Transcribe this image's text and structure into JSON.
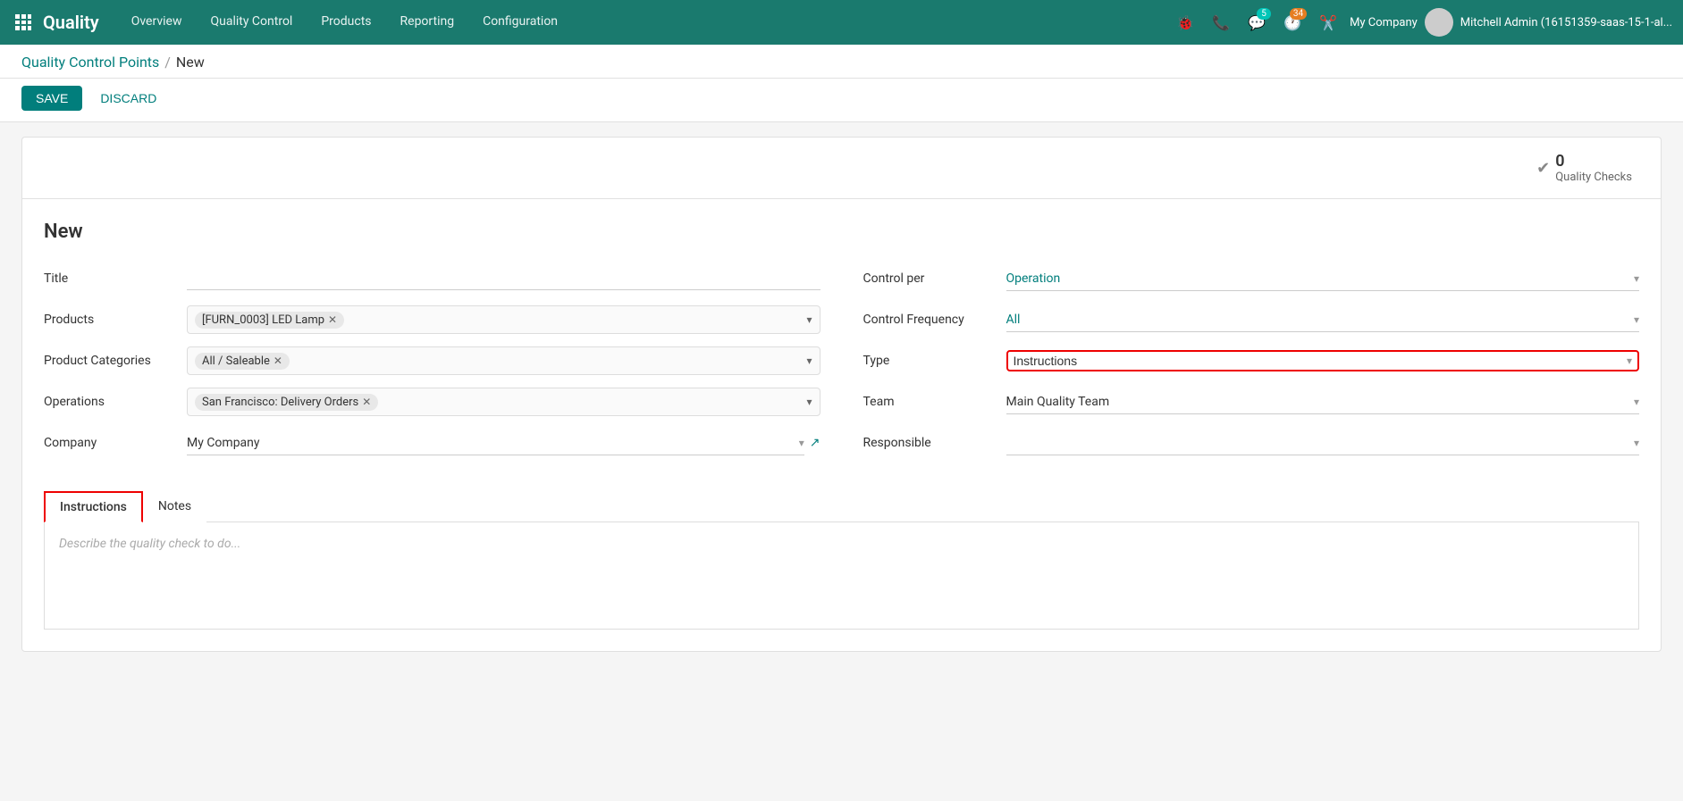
{
  "nav": {
    "app_name": "Quality",
    "menu_items": [
      "Overview",
      "Quality Control",
      "Products",
      "Reporting",
      "Configuration"
    ],
    "badge_chat": "5",
    "badge_clock": "34",
    "company": "My Company",
    "user": "Mitchell Admin (16151359-saas-15-1-al..."
  },
  "breadcrumb": {
    "parent": "Quality Control Points",
    "separator": "/",
    "current": "New"
  },
  "actions": {
    "save": "SAVE",
    "discard": "DISCARD"
  },
  "smart_buttons": {
    "quality_checks_count": "0",
    "quality_checks_label": "Quality Checks"
  },
  "form": {
    "title": "New",
    "fields_left": {
      "title_label": "Title",
      "title_value": "",
      "products_label": "Products",
      "products_tag": "[FURN_0003] LED Lamp",
      "product_categories_label": "Product Categories",
      "product_categories_tag": "All / Saleable",
      "operations_label": "Operations",
      "operations_tag": "San Francisco: Delivery Orders",
      "company_label": "Company",
      "company_value": "My Company"
    },
    "fields_right": {
      "control_per_label": "Control per",
      "control_per_value": "Operation",
      "control_frequency_label": "Control Frequency",
      "control_frequency_value": "All",
      "type_label": "Type",
      "type_value": "Instructions",
      "team_label": "Team",
      "team_value": "Main Quality Team",
      "responsible_label": "Responsible",
      "responsible_value": ""
    }
  },
  "tabs": {
    "instructions_label": "Instructions",
    "notes_label": "Notes",
    "instructions_placeholder": "Describe the quality check to do..."
  }
}
